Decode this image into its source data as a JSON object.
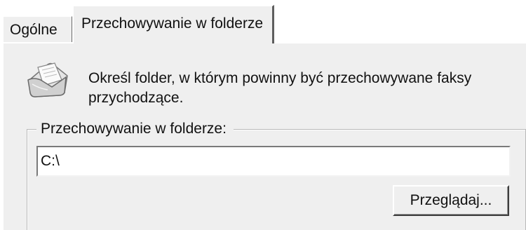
{
  "tabs": [
    {
      "label": "Ogólne",
      "selected": false
    },
    {
      "label": "Przechowywanie w folderze",
      "selected": true
    }
  ],
  "panel": {
    "icon": "fax-folder-icon",
    "description": "Określ folder, w którym powinny być przechowywane faksy przychodzące.",
    "group": {
      "legend": "Przechowywanie w folderze:",
      "path_value": "C:\\",
      "browse_label": "Przeglądaj..."
    }
  }
}
